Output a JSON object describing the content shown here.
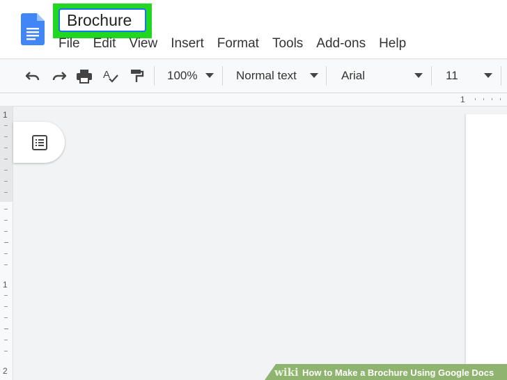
{
  "document": {
    "title": "Brochure"
  },
  "app": {
    "logo_icon": "google-docs-icon",
    "highlight_color": "#22d722",
    "accent_color": "#1a73e8"
  },
  "menu": [
    "File",
    "Edit",
    "View",
    "Insert",
    "Format",
    "Tools",
    "Add-ons",
    "Help"
  ],
  "toolbar": {
    "icons": [
      "undo-icon",
      "redo-icon",
      "print-icon",
      "spellcheck-icon",
      "paint-format-icon"
    ],
    "zoom": "100%",
    "style": "Normal text",
    "font": "Arial",
    "font_size": "11"
  },
  "ruler": {
    "horizontal_label": "1",
    "vertical_labels": [
      "1",
      "1",
      "2"
    ]
  },
  "outline": {
    "icon": "document-outline-icon"
  },
  "watermark": {
    "prefix": "wiki",
    "title": "How to Make a Brochure Using Google Docs"
  }
}
